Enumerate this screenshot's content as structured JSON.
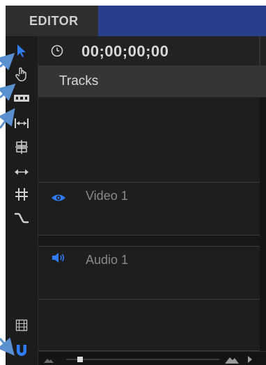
{
  "app": {
    "panel_title": "EDITOR"
  },
  "timeline": {
    "timecode": "00;00;00;00",
    "tracks_header": "Tracks",
    "tracks": [
      {
        "label": "Video 1",
        "icon": "eye-icon"
      },
      {
        "label": "Audio 1",
        "icon": "speaker-icon"
      }
    ]
  },
  "toolbar": {
    "tools": [
      "select-tool-icon",
      "hand-tool-icon",
      "ripple-tool-icon",
      "slip-tool-icon",
      "slide-tool-icon",
      "rate-stretch-tool-icon",
      "razor-tool-icon",
      "link-tool-icon",
      "filmstrip-icon",
      "snap-magnet-icon"
    ]
  },
  "colors": {
    "accent_blue": "#2f7cf6",
    "header_bar": "#28408c",
    "annotation_arrow": "#5a8fd0"
  }
}
